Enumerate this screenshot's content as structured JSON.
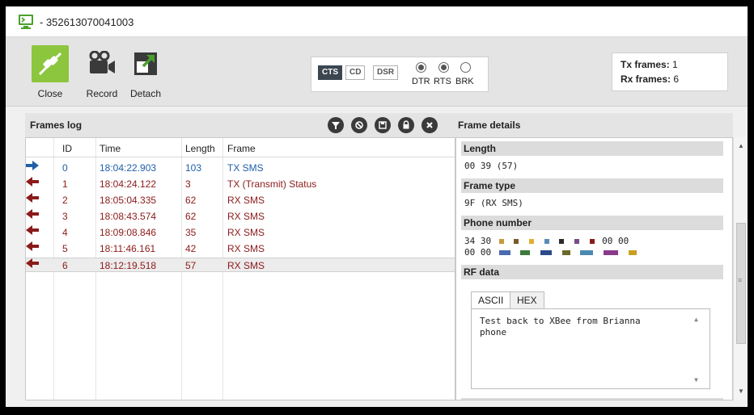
{
  "window": {
    "title": "- 352613070041003",
    "icon": "monitor-icon"
  },
  "toolbar": {
    "close_label": "Close",
    "record_label": "Record",
    "detach_label": "Detach",
    "signals": {
      "cts": "CTS",
      "cd": "CD",
      "dsr": "DSR",
      "dtr": "DTR",
      "rts": "RTS",
      "brk": "BRK",
      "dtr_on": true,
      "rts_on": true,
      "brk_on": false
    },
    "tx_frames_label": "Tx frames:",
    "tx_frames_value": "1",
    "rx_frames_label": "Rx frames:",
    "rx_frames_value": "6"
  },
  "log": {
    "title": "Frames log",
    "columns": {
      "id": "ID",
      "time": "Time",
      "length": "Length",
      "frame": "Frame"
    },
    "rows": [
      {
        "dir": "tx",
        "id": "0",
        "time": "18:04:22.903",
        "length": "103",
        "frame": "TX SMS"
      },
      {
        "dir": "rx",
        "id": "1",
        "time": "18:04:24.122",
        "length": "3",
        "frame": "TX (Transmit) Status"
      },
      {
        "dir": "rx",
        "id": "2",
        "time": "18:05:04.335",
        "length": "62",
        "frame": "RX SMS"
      },
      {
        "dir": "rx",
        "id": "3",
        "time": "18:08:43.574",
        "length": "62",
        "frame": "RX SMS"
      },
      {
        "dir": "rx",
        "id": "4",
        "time": "18:09:08.846",
        "length": "35",
        "frame": "RX SMS"
      },
      {
        "dir": "rx",
        "id": "5",
        "time": "18:11:46.161",
        "length": "42",
        "frame": "RX SMS"
      },
      {
        "dir": "rx",
        "id": "6",
        "time": "18:12:19.518",
        "length": "57",
        "frame": "RX SMS"
      }
    ]
  },
  "details": {
    "title": "Frame details",
    "length_label": "Length",
    "length_value": "00 39 (57)",
    "frame_type_label": "Frame type",
    "frame_type_value": "9F (RX SMS)",
    "phone_label": "Phone number",
    "phone_line1_start": "34 30",
    "phone_line1_end": "00 00",
    "phone_line2_start": "00 00",
    "rf_label": "RF data",
    "tab_ascii": "ASCII",
    "tab_hex": "HEX",
    "rf_text": "Test back to XBee from Brianna phone"
  },
  "colors": {
    "close_button": "#8cc63f",
    "tx": "#1f5fa8",
    "rx": "#8b1a1a",
    "cts_active": "#3b4651"
  }
}
